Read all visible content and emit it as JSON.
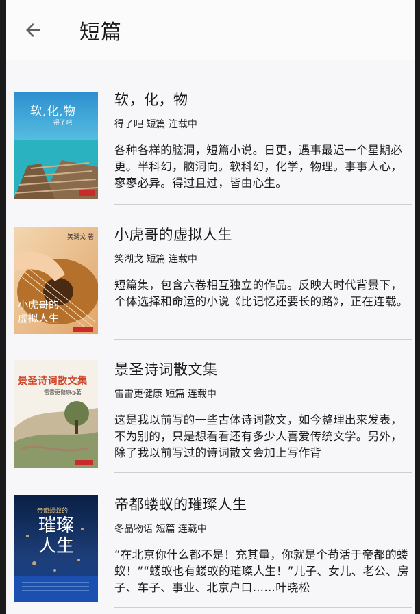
{
  "header": {
    "title": "短篇",
    "back_icon": "arrow-left-icon"
  },
  "books": [
    {
      "title": "软，化，物",
      "meta": "得了吧 短篇 连载中",
      "description": "各种各样的脑洞，短篇小说。日更，遇事最迟一个星期必更。半科幻，脑洞向。软科幻，化学，物理。事事人心，寥寥必异。得过且过，皆由心生。",
      "cover_title": "软,化,物",
      "cover_author": "得了吧",
      "cover_colors": [
        "#3fb6d6",
        "#8a6a4a"
      ]
    },
    {
      "title": "小虎哥的虚拟人生",
      "meta": "笑湖戈 短篇 连载中",
      "description": "短篇集，包含六卷相互独立的作品。反映大时代背景下，个体选择和命运的小说《比记忆还要长的路》，正在连载。",
      "cover_title": "小虎哥的虚拟人生",
      "cover_author": "笑湖戈 著",
      "cover_colors": [
        "#c98a3c",
        "#f0c9a0"
      ]
    },
    {
      "title": "景圣诗词散文集",
      "meta": "雷雷更健康 短篇 连载中",
      "description": "这是我以前写的一些古体诗词散文，如今整理出来发表，不为别的，只是想看看还有多少人喜爱传统文学。另外，除了我以前写过的诗词散文会加上写作背",
      "cover_title": "景圣诗词散文集",
      "cover_author": "雷雷更健康◎著",
      "cover_colors": [
        "#f4efe6",
        "#d0462a"
      ]
    },
    {
      "title": "帝都蝼蚁的璀璨人生",
      "meta": "冬晶物语 短篇 连载中",
      "description": "“在北京你什么都不是！充其量，你就是个苟活于帝都的蝼蚁！”“蝼蚁也有蝼蚁的璀璨人生！”儿子、女儿、老公、房子、车子、事业、北京户口……叶晓松",
      "cover_title": "璀璨人生",
      "cover_author": "帝都蝼蚁的",
      "cover_colors": [
        "#0d2a5c",
        "#d8b06a"
      ]
    }
  ]
}
